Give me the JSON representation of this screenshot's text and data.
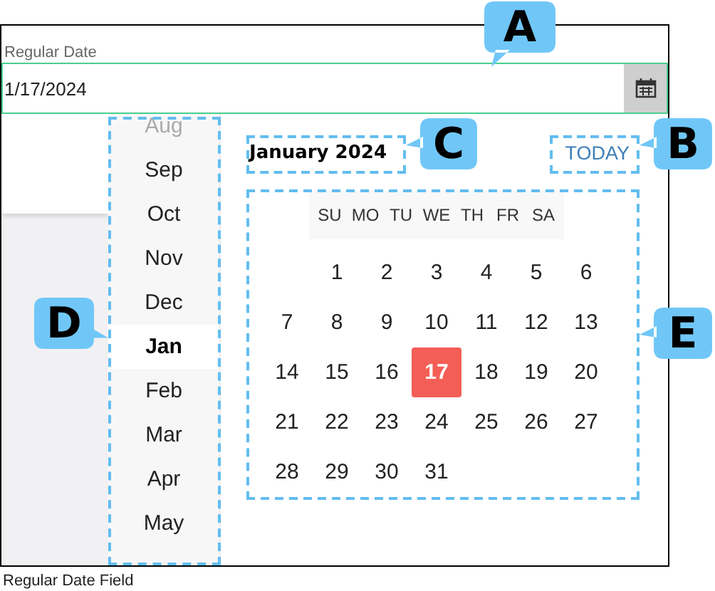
{
  "field": {
    "label": "Regular Date",
    "value": "1/17/2024"
  },
  "months": [
    {
      "name": "Aug",
      "selected": false,
      "faded": true
    },
    {
      "name": "Sep",
      "selected": false,
      "faded": false
    },
    {
      "name": "Oct",
      "selected": false,
      "faded": false
    },
    {
      "name": "Nov",
      "selected": false,
      "faded": false
    },
    {
      "name": "Dec",
      "selected": false,
      "faded": false
    },
    {
      "name": "Jan",
      "selected": true,
      "faded": false
    },
    {
      "name": "Feb",
      "selected": false,
      "faded": false
    },
    {
      "name": "Mar",
      "selected": false,
      "faded": false
    },
    {
      "name": "Apr",
      "selected": false,
      "faded": false
    },
    {
      "name": "May",
      "selected": false,
      "faded": false
    }
  ],
  "calendar": {
    "title": "January 2024",
    "today_button": "TODAY",
    "weekdays": [
      "SU",
      "MO",
      "TU",
      "WE",
      "TH",
      "FR",
      "SA"
    ],
    "weeks": [
      [
        {
          "day": "1",
          "selected": false
        },
        {
          "day": "2",
          "selected": false
        },
        {
          "day": "3",
          "selected": false
        },
        {
          "day": "4",
          "selected": false
        },
        {
          "day": "5",
          "selected": false
        },
        {
          "day": "6",
          "selected": false
        }
      ],
      [
        {
          "day": "7",
          "selected": false
        },
        {
          "day": "8",
          "selected": false
        },
        {
          "day": "9",
          "selected": false
        },
        {
          "day": "10",
          "selected": false
        },
        {
          "day": "11",
          "selected": false
        },
        {
          "day": "12",
          "selected": false
        },
        {
          "day": "13",
          "selected": false
        }
      ],
      [
        {
          "day": "14",
          "selected": false
        },
        {
          "day": "15",
          "selected": false
        },
        {
          "day": "16",
          "selected": false
        },
        {
          "day": "17",
          "selected": true
        },
        {
          "day": "18",
          "selected": false
        },
        {
          "day": "19",
          "selected": false
        },
        {
          "day": "20",
          "selected": false
        }
      ],
      [
        {
          "day": "21",
          "selected": false
        },
        {
          "day": "22",
          "selected": false
        },
        {
          "day": "23",
          "selected": false
        },
        {
          "day": "24",
          "selected": false
        },
        {
          "day": "25",
          "selected": false
        },
        {
          "day": "26",
          "selected": false
        },
        {
          "day": "27",
          "selected": false
        }
      ],
      [
        {
          "day": "28",
          "selected": false
        },
        {
          "day": "29",
          "selected": false
        },
        {
          "day": "30",
          "selected": false
        },
        {
          "day": "31",
          "selected": false
        }
      ]
    ]
  },
  "callouts": [
    {
      "letter": "A"
    },
    {
      "letter": "B"
    },
    {
      "letter": "C"
    },
    {
      "letter": "D"
    },
    {
      "letter": "E"
    }
  ],
  "caption": "Regular Date Field"
}
